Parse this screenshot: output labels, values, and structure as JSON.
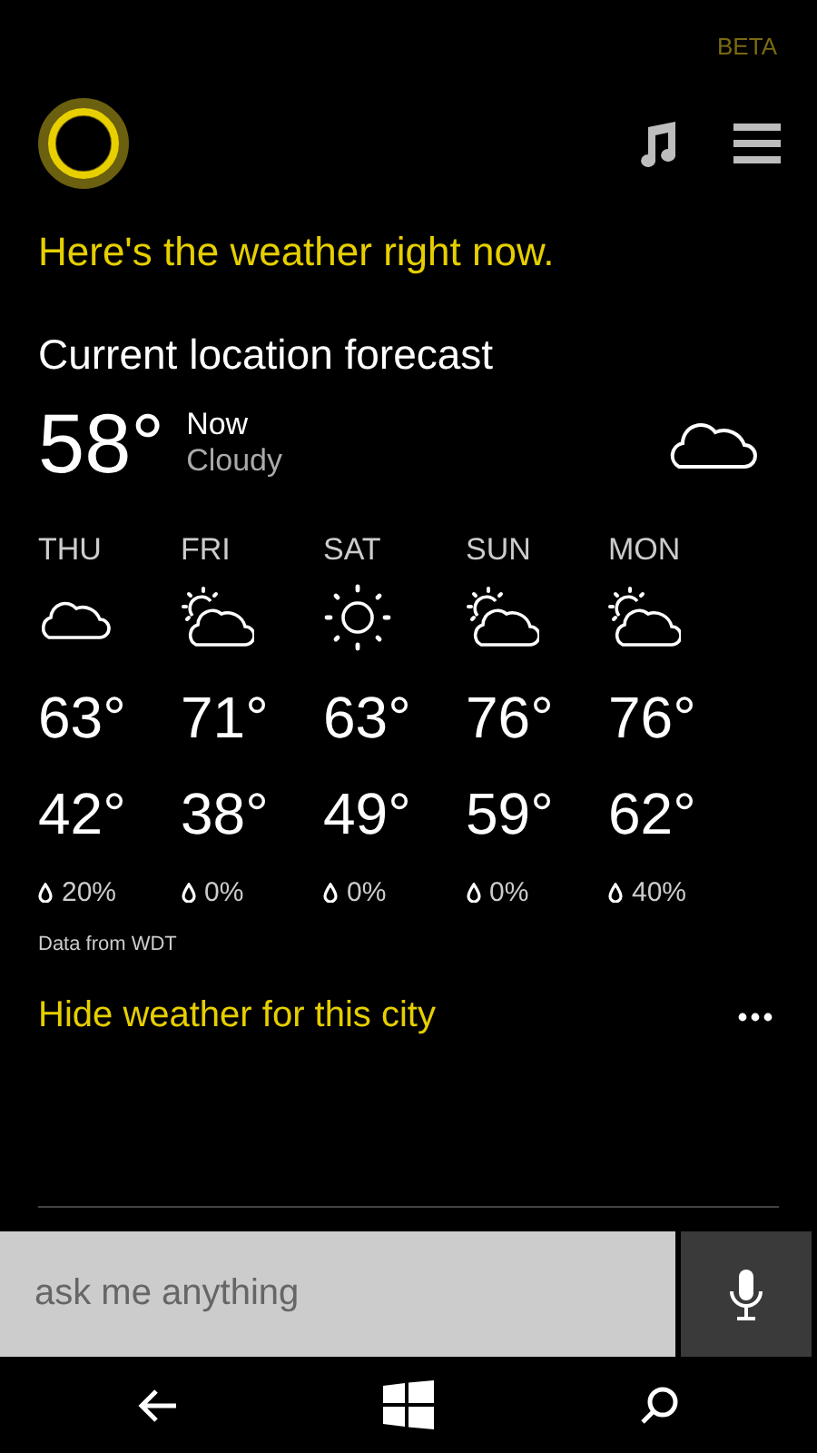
{
  "header": {
    "badge": "BETA"
  },
  "headline": "Here's the weather right now.",
  "forecast": {
    "title": "Current location forecast",
    "temperature": "58°",
    "time": "Now",
    "condition": "Cloudy",
    "kind": "cloudy",
    "days": [
      {
        "day": "THU",
        "kind": "cloudy",
        "high": "63°",
        "low": "42°",
        "precip": "20%"
      },
      {
        "day": "FRI",
        "kind": "partly_sunny",
        "high": "71°",
        "low": "38°",
        "precip": "0%"
      },
      {
        "day": "SAT",
        "kind": "sunny",
        "high": "63°",
        "low": "49°",
        "precip": "0%"
      },
      {
        "day": "SUN",
        "kind": "partly_sunny",
        "high": "76°",
        "low": "59°",
        "precip": "0%"
      },
      {
        "day": "MON",
        "kind": "partly_sunny",
        "high": "76°",
        "low": "62°",
        "precip": "40%"
      }
    ],
    "source": "Data from WDT"
  },
  "action": {
    "label": "Hide weather for this city"
  },
  "search": {
    "placeholder": "ask me anything"
  }
}
